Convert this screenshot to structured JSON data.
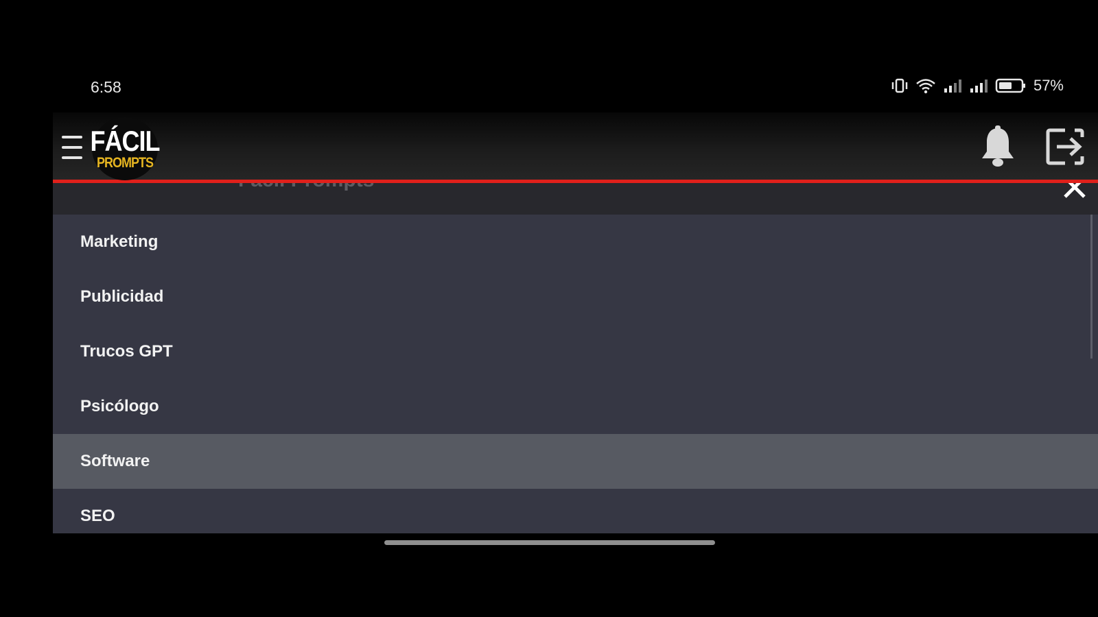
{
  "status_bar": {
    "time": "6:58",
    "battery_percent": "57%",
    "icons": [
      "vibrate-icon",
      "wifi-icon",
      "signal-icon",
      "signal-icon",
      "battery-icon"
    ]
  },
  "header": {
    "logo_top": "FÁCIL",
    "logo_bottom": "PROMPTS",
    "icons": [
      "hamburger-menu-icon",
      "bell-icon",
      "logout-icon"
    ],
    "accent_color": "#e0201b"
  },
  "drawer": {
    "title": "Fácil Prompts",
    "items": [
      {
        "label": "Marketing"
      },
      {
        "label": "Publicidad"
      },
      {
        "label": "Trucos GPT"
      },
      {
        "label": "Psicólogo"
      },
      {
        "label": "Software"
      },
      {
        "label": "SEO"
      }
    ],
    "selected_item": "Software"
  }
}
